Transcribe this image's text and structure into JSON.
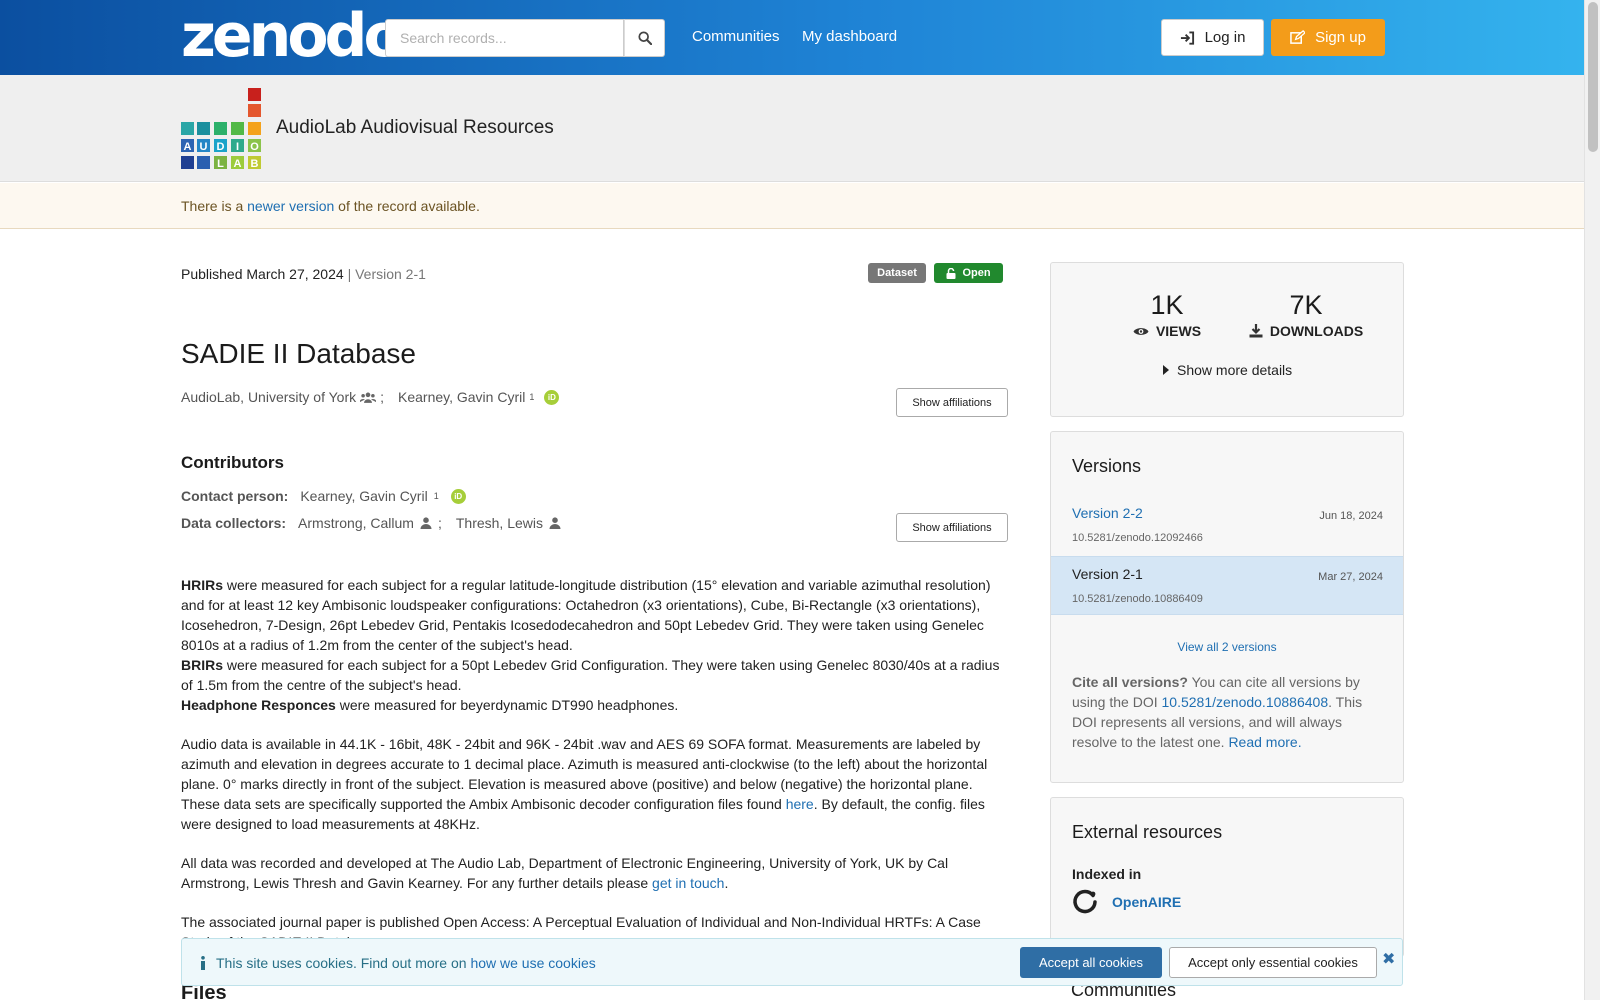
{
  "header": {
    "logo": "zenodo",
    "search_placeholder": "Search records...",
    "nav": [
      "Communities",
      "My dashboard"
    ],
    "login": "Log in",
    "signup": "Sign up"
  },
  "community": {
    "logo_letters": [
      "A",
      "U",
      "D",
      "I",
      "O",
      "L",
      "A",
      "B"
    ],
    "name": "AudioLab Audiovisual Resources"
  },
  "notice": {
    "prefix": "There is a ",
    "link": "newer version",
    "suffix": " of the record available."
  },
  "record": {
    "published": "Published March 27, 2024",
    "version": "| Version 2-1",
    "badges": {
      "type": "Dataset",
      "access": "Open"
    },
    "title": "SADIE II Database",
    "creators": [
      {
        "name": "AudioLab, University of York",
        "kind": "group"
      },
      {
        "name": "Kearney, Gavin Cyril",
        "sup": "1",
        "orcid": true
      }
    ],
    "show_affiliations": "Show affiliations",
    "contributors_heading": "Contributors",
    "contact_label": "Contact person:",
    "contact": {
      "name": "Kearney, Gavin Cyril",
      "sup": "1"
    },
    "collectors_label": "Data collectors:",
    "collectors": [
      "Armstrong, Callum",
      "Thresh, Lewis"
    ],
    "separator": ";",
    "orcid_text": "iD"
  },
  "description": {
    "p1_b1": "HRIRs",
    "p1_t1": " were measured for each subject for a regular latitude-longitude distribution (15° elevation and variable azimuthal resolution) and for at least 12 key Ambisonic loudspeaker configurations: Octahedron (x3 orientations), Cube, Bi-Rectangle (x3 orientations), Icosehedron, 7-Design, 26pt Lebedev Grid, Pentakis Icosedodecahedron and 50pt Lebedev Grid. They were taken using Genelec 8010s at a radius of 1.2m from the center of the subject's head.",
    "p1_b2": "BRIRs",
    "p1_t2": " were measured for each subject for a 50pt Lebedev Grid Configuration. They were taken using Genelec 8030/40s at a radius of 1.5m from the centre of the subject's head.",
    "p1_b3": "Headphone Responces",
    "p1_t3": " were measured for beyerdynamic DT990 headphones.",
    "p2_t1": "Audio data is available in 44.1K - 16bit, 48K - 24bit and 96K - 24bit .wav and AES 69 SOFA format. Measurements are labeled by azimuth and elevation in degrees accurate to 1 decimal place. Azimuth is measured anti-clockwise (to the left) about the horizontal plane. 0° marks directly in front of the subject. Elevation is measured above (positive) and below (negative) the horizontal plane. These data sets are specifically supported the Ambix Ambisonic decoder configuration files found ",
    "p2_link": "here",
    "p2_t2": ". By default, the config. files were designed to load measurements at 48KHz.",
    "p3_t1": "All data was recorded and developed at The Audio Lab, Department of Electronic Engineering, University of York, UK by Cal Armstrong, Lewis Thresh and Gavin Kearney. For any further details please ",
    "p3_link": "get in touch",
    "p3_t2": ".",
    "p4_t1": "The associated journal paper is published Open Access: A Perceptual Evaluation of Individual and Non-Individual HRTFs: A Case Study of the SADIE II Database"
  },
  "files_heading": "Files",
  "stats": {
    "views": "1K",
    "views_label": "VIEWS",
    "downloads": "7K",
    "downloads_label": "DOWNLOADS",
    "more": "Show more details"
  },
  "versions": {
    "title": "Versions",
    "items": [
      {
        "name": "Version 2-2",
        "doi": "10.5281/zenodo.12092466",
        "date": "Jun 18, 2024",
        "active": false
      },
      {
        "name": "Version 2-1",
        "doi": "10.5281/zenodo.10886409",
        "date": "Mar 27, 2024",
        "active": true
      }
    ],
    "view_all": "View all 2 versions",
    "cite_bold": "Cite all versions?",
    "cite_t1": " You can cite all versions by using the DOI ",
    "cite_doi": "10.5281/zenodo.10886408",
    "cite_t2": ". This DOI represents all versions, and will always resolve to the latest one. ",
    "read_more": "Read more."
  },
  "external": {
    "title": "External resources",
    "indexed_in": "Indexed in",
    "provider": "OpenAIRE"
  },
  "next_panel_title": "Communities",
  "cookie": {
    "text": "This site uses cookies. Find out more on ",
    "link": "how we use cookies",
    "accept_all": "Accept all cookies",
    "accept_essential": "Accept only essential cookies"
  },
  "colors": {
    "header_start": "#0b4fa0",
    "header_end": "#34b3ee",
    "signup": "#f39c1a",
    "open_badge": "#21892e",
    "link": "#1f6fb2",
    "active_version": "#d5e6f5"
  },
  "icons": [
    "search-icon",
    "login-icon",
    "edit-icon",
    "group-icon",
    "person-icon",
    "orcid-icon",
    "lock-open-icon",
    "eye-icon",
    "download-icon",
    "caret-right-icon",
    "openaire-icon",
    "info-icon",
    "close-icon"
  ]
}
